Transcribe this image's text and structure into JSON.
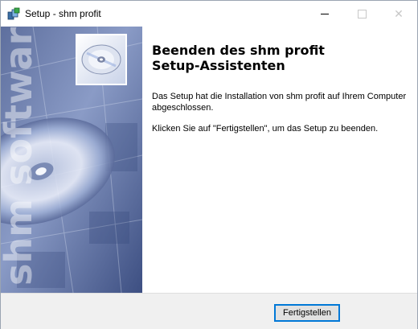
{
  "window": {
    "title": "Setup - shm profit",
    "minimize_label": "",
    "maximize_label": "",
    "close_glyph": "✕"
  },
  "sidebar": {
    "watermark_text": "shm software",
    "icon": "cd-disc-icon"
  },
  "content": {
    "heading_line1": "Beenden des shm profit",
    "heading_line2": "Setup-Assistenten",
    "paragraph1": "Das Setup hat die Installation von shm profit auf Ihrem Computer abgeschlossen.",
    "paragraph2": "Klicken Sie auf \"Fertigstellen\", um das Setup zu beenden."
  },
  "footer": {
    "finish_label": "Fertigstellen"
  },
  "colors": {
    "sidebar_dark": "#2c3e73",
    "sidebar_light": "#a9b7d8",
    "button_focus": "#0078d7"
  }
}
